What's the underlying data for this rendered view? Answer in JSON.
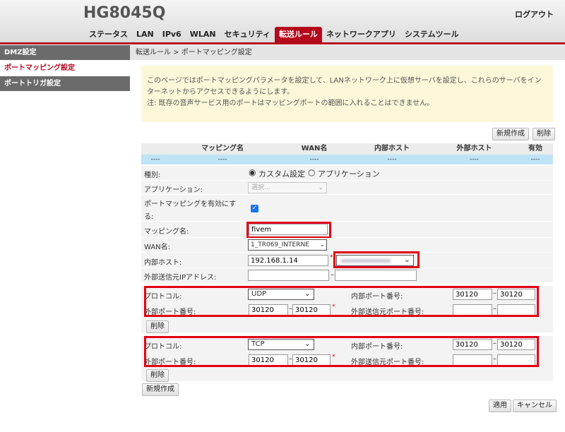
{
  "header": {
    "brand": "HG8045Q",
    "logout": "ログアウト"
  },
  "nav": [
    "ステータス",
    "LAN",
    "IPv6",
    "WLAN",
    "セキュリティ",
    "転送ルール",
    "ネットワークアプリ",
    "システムツール"
  ],
  "sidebar": [
    "DMZ設定",
    "ポートマッピング設定",
    "ポートトリガ設定"
  ],
  "breadcrumb": "転送ルール > ポートマッピング設定",
  "notice": {
    "line1": "このページではポートマッピングパラメータを設定して、LANネットワーク上に仮想サーバを設定し、これらのサーバをイン",
    "line2": "ターネットからアクセスできるようにします。",
    "line3": "注: 既存の音声サービス用のポートはマッピングポートの範囲に入れることはできません。"
  },
  "buttons": {
    "new": "新規作成",
    "delete": "削除",
    "apply": "適用",
    "cancel": "キャンセル"
  },
  "table": {
    "headers": [
      "",
      "マッピング名",
      "WAN名",
      "内部ホスト",
      "外部ホスト",
      "有効"
    ],
    "row": [
      "----",
      "----",
      "----",
      "----",
      "----",
      "----"
    ]
  },
  "form": {
    "type_label": "種別:",
    "type_custom": "カスタム設定",
    "type_app": "アプリケーション",
    "app_label": "アプリケーション:",
    "app_placeholder": "選択...",
    "enable_label1": "ポートマッピングを有効にす",
    "enable_label2": "る:",
    "name_label": "マッピング名:",
    "name_value": "fivem",
    "wan_label": "WAN名:",
    "wan_value": "1_TR069_INTERNE",
    "host_label": "内部ホスト:",
    "host_value": "192.168.1.14",
    "ext_ip_label": "外部送信元IPアドレス:"
  },
  "protocols": [
    {
      "protocol": "UDP",
      "int_start": "30120",
      "int_end": "30120",
      "ext_start": "30120",
      "ext_end": "30120"
    },
    {
      "protocol": "TCP",
      "int_start": "30120",
      "int_end": "30120",
      "ext_start": "30120",
      "ext_end": "30120"
    }
  ],
  "proto_labels": {
    "protocol": "プロトコル:",
    "int_port": "内部ポート番号:",
    "ext_port": "外部ポート番号:",
    "ext_src_port": "外部送信元ポート番号:"
  },
  "colors": {
    "accent": "#b5081c",
    "highlight": "#e20012",
    "notice_bg": "#fbf7d8"
  }
}
